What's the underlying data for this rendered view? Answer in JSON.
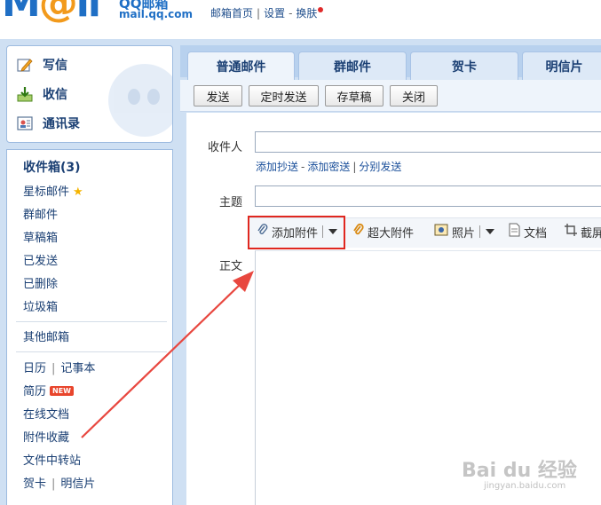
{
  "header": {
    "logo_big": "M",
    "logo_o": "@",
    "logo_tail": "il",
    "logo_sub1": "QQ邮箱",
    "logo_sub2": "mail.qq.com",
    "links": [
      "邮箱首页",
      "设置",
      "换肤"
    ],
    "sep": "|",
    "dash": "-"
  },
  "sidebar": {
    "compose": "写信",
    "inbox": "收信",
    "contacts": "通讯录",
    "folders": {
      "inbox_count": "收件箱(3)",
      "starred": "星标邮件",
      "group": "群邮件",
      "drafts": "草稿箱",
      "sent": "已发送",
      "deleted": "已删除",
      "spam": "垃圾箱",
      "other": "其他邮箱",
      "calendar": "日历",
      "notes": "记事本",
      "resume": "简历",
      "new_badge": "NEW",
      "online_docs": "在线文档",
      "attachments": "附件收藏",
      "transfer": "文件中转站",
      "cards": "贺卡",
      "postcards": "明信片",
      "pipe": "|"
    }
  },
  "tabs": [
    "普通邮件",
    "群邮件",
    "贺卡",
    "明信片"
  ],
  "toolbar": {
    "send": "发送",
    "scheduled": "定时发送",
    "save_draft": "存草稿",
    "close": "关闭"
  },
  "compose": {
    "to_label": "收件人",
    "cc_links": {
      "add_cc": "添加抄送",
      "add_bcc": "添加密送",
      "separate": "分别发送",
      "dash": "-",
      "pipe": "|"
    },
    "subject_label": "主题",
    "body_label": "正文",
    "tools": {
      "add_attachment": "添加附件",
      "large_attachment": "超大附件",
      "photo": "照片",
      "document": "文档",
      "screenshot": "截屏"
    }
  },
  "colors": {
    "highlight": "#e0271f",
    "arrow": "#e8473f",
    "accent": "#1f6fc5"
  },
  "watermark": {
    "main": "Bai du 经验",
    "sub": "jingyan.baidu.com"
  }
}
